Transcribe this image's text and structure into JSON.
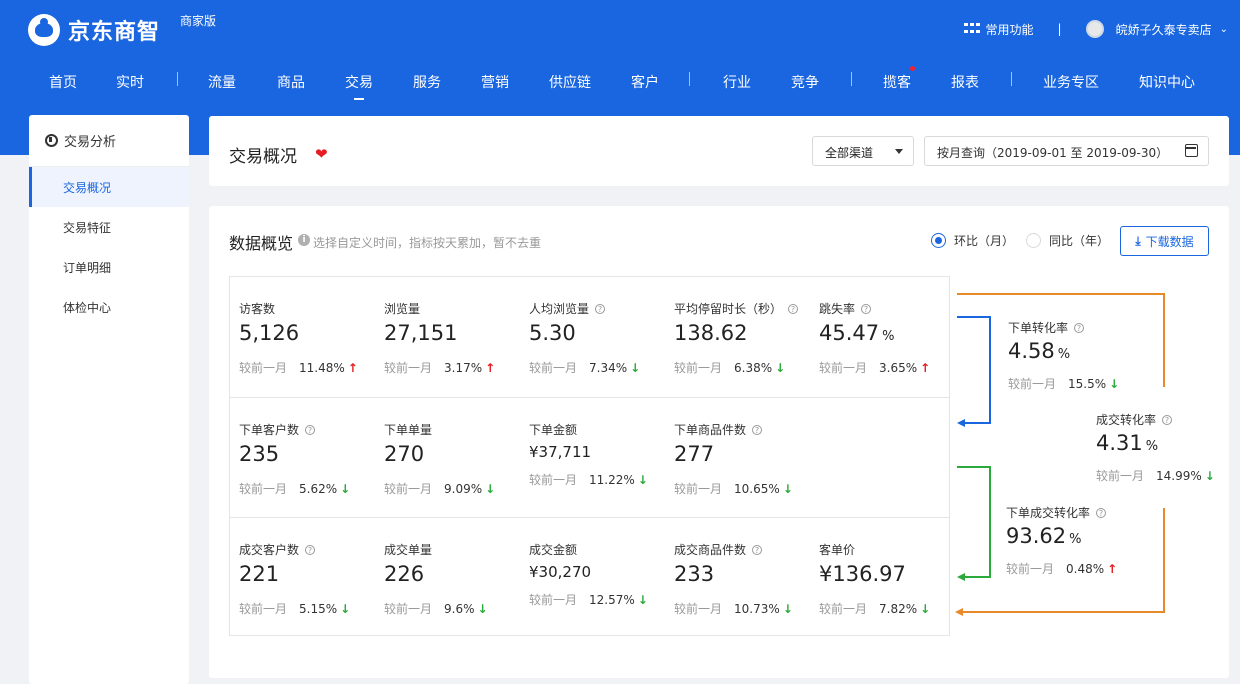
{
  "header": {
    "brand": "京东商智",
    "edition": "商家版",
    "common_functions": "常用功能",
    "separator": "|",
    "shop_name": "皖娇子久泰专卖店"
  },
  "nav": {
    "items": [
      "首页",
      "实时",
      "流量",
      "商品",
      "交易",
      "服务",
      "营销",
      "供应链",
      "客户",
      "行业",
      "竞争",
      "揽客",
      "报表",
      "业务专区",
      "知识中心"
    ],
    "active": "交易"
  },
  "sidebar": {
    "title": "交易分析",
    "items": [
      "交易概况",
      "交易特征",
      "订单明细",
      "体检中心"
    ],
    "active": "交易概况"
  },
  "title_card": {
    "title": "交易概况",
    "channel": "全部渠道",
    "date_range": "按月查询（2019-09-01 至 2019-09-30）"
  },
  "overview": {
    "title": "数据概览",
    "hint": "选择自定义时间，指标按天累加，暂不去重",
    "radio_mom": "环比（月）",
    "radio_yoy": "同比（年）",
    "download": "下载数据",
    "compare_label": "较前一月",
    "rows": [
      [
        {
          "label": "访客数",
          "value": "5,126",
          "unit": "",
          "pct": "11.48%",
          "dir": "up",
          "help": false
        },
        {
          "label": "浏览量",
          "value": "27,151",
          "unit": "",
          "pct": "3.17%",
          "dir": "up",
          "help": false
        },
        {
          "label": "人均浏览量",
          "value": "5.30",
          "unit": "",
          "pct": "7.34%",
          "dir": "down",
          "help": true
        },
        {
          "label": "平均停留时长（秒）",
          "value": "138.62",
          "unit": "",
          "pct": "6.38%",
          "dir": "down",
          "help": true
        },
        {
          "label": "跳失率",
          "value": "45.47",
          "unit": "%",
          "pct": "3.65%",
          "dir": "up",
          "help": true
        }
      ],
      [
        {
          "label": "下单客户数",
          "value": "235",
          "unit": "",
          "pct": "5.62%",
          "dir": "down",
          "help": true
        },
        {
          "label": "下单单量",
          "value": "270",
          "unit": "",
          "pct": "9.09%",
          "dir": "down",
          "help": false
        },
        {
          "label": "下单金额",
          "value": "¥37,711",
          "unit": "",
          "pct": "11.22%",
          "dir": "down",
          "help": false,
          "money": true
        },
        {
          "label": "下单商品件数",
          "value": "277",
          "unit": "",
          "pct": "10.65%",
          "dir": "down",
          "help": true
        }
      ],
      [
        {
          "label": "成交客户数",
          "value": "221",
          "unit": "",
          "pct": "5.15%",
          "dir": "down",
          "help": true
        },
        {
          "label": "成交单量",
          "value": "226",
          "unit": "",
          "pct": "9.6%",
          "dir": "down",
          "help": false
        },
        {
          "label": "成交金额",
          "value": "¥30,270",
          "unit": "",
          "pct": "12.57%",
          "dir": "down",
          "help": false,
          "money": true
        },
        {
          "label": "成交商品件数",
          "value": "233",
          "unit": "",
          "pct": "10.73%",
          "dir": "down",
          "help": true
        },
        {
          "label": "客单价",
          "value": "¥136.97",
          "unit": "",
          "pct": "7.82%",
          "dir": "down",
          "help": false
        }
      ]
    ],
    "conversions": [
      {
        "label": "下单转化率",
        "value": "4.58",
        "unit": "%",
        "pct": "15.5%",
        "dir": "down"
      },
      {
        "label": "成交转化率",
        "value": "4.31",
        "unit": "%",
        "pct": "14.99%",
        "dir": "down"
      },
      {
        "label": "下单成交转化率",
        "value": "93.62",
        "unit": "%",
        "pct": "0.48%",
        "dir": "up"
      }
    ]
  },
  "colors": {
    "brand_blue": "#1966e0",
    "up": "#e51c23",
    "down": "#2aaa3a",
    "flow_blue": "#1966e0",
    "flow_green": "#2aaa3a",
    "flow_orange": "#e8892c"
  }
}
